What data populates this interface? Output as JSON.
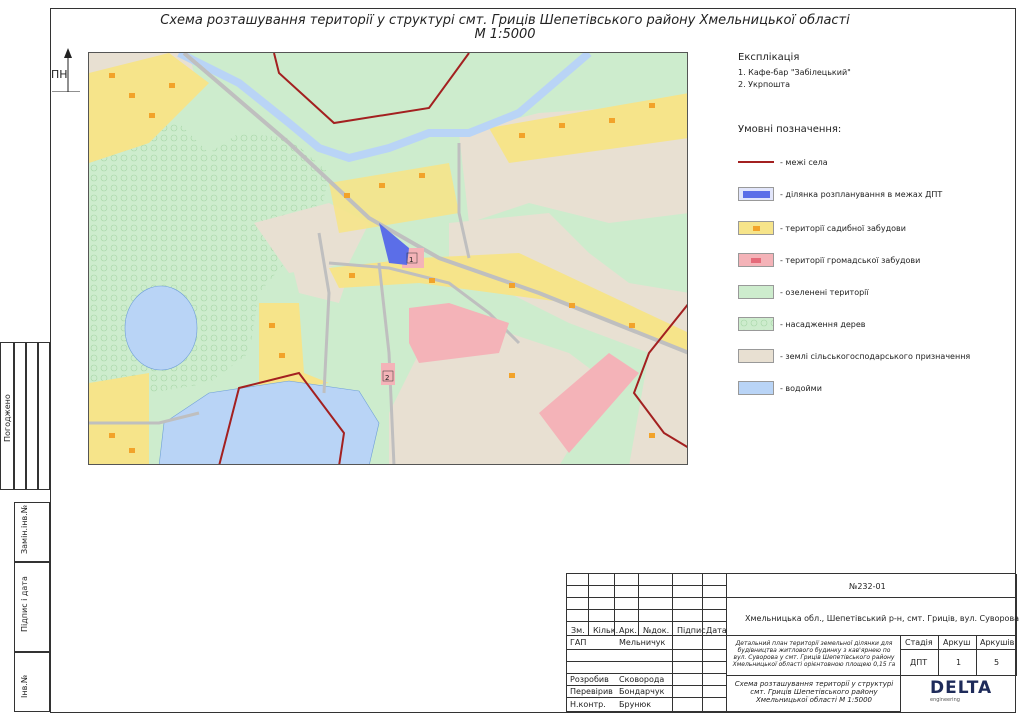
{
  "title": {
    "line1": "Схема розташування території у структурі смт. Гриців Шепетівського району Хмельницької області",
    "line2": "М 1:5000"
  },
  "north_label": "ПН",
  "map_labels": {
    "site1": "1",
    "site2": "2"
  },
  "legend": {
    "explication_heading": "Експлікація",
    "explication_items": [
      "1. Кафе-бар \"Забілецький\"",
      "2. Укрпошта"
    ],
    "symbols_heading": "Умовні позначення:",
    "items": [
      {
        "label": "- межі села",
        "kind": "line",
        "color": "#a32020"
      },
      {
        "label": "- ділянка розпланування в межах ДПТ",
        "kind": "fill",
        "color": "#5b6ee8"
      },
      {
        "label": "- території садибної забудови",
        "kind": "fill",
        "color": "#f6e48a"
      },
      {
        "label": "- території громадської забудови",
        "kind": "fill",
        "color": "#f4b3b8"
      },
      {
        "label": "- озеленені території",
        "kind": "fill",
        "color": "#cdeccd"
      },
      {
        "label": "- насадження дерев",
        "kind": "fill",
        "color": "#cdeccd"
      },
      {
        "label": "- землі сільськогосподарського призначення",
        "kind": "fill",
        "color": "#e8e0d2"
      },
      {
        "label": "- водойми",
        "kind": "fill",
        "color": "#b9d4f6"
      }
    ]
  },
  "side": {
    "agreed": "Погоджено",
    "replaced": "Замін.інв.№",
    "sign_date": "Підпис і дата",
    "inv": "Інв.№"
  },
  "stamp": {
    "doc_number": "№232-01",
    "location": "Хмельницька обл., Шепетівський р-н, смт. Гриців, вул. Суворова",
    "headers": [
      "Зм.",
      "Кільк.",
      "Арк.",
      "№док.",
      "Підпис",
      "Дата"
    ],
    "roles": [
      {
        "role": "ГАП",
        "name": "Мельничук"
      },
      {
        "role": "Розробив",
        "name": "Сковорода"
      },
      {
        "role": "Перевірив",
        "name": "Бондарчук"
      },
      {
        "role": "Н.контр.",
        "name": "Брунюк"
      }
    ],
    "project_desc": "Детальний план території земельної ділянки для будівництва житлового будинку з кав'ярнею по вул. Суворова у смт. Гриців Шепетівського району Хмельницької області орієнтовною площею 0,15 га",
    "stage_header": "Стадія",
    "sheet_header": "Аркуш",
    "sheets_header": "Аркушів",
    "stage": "ДПТ",
    "sheet": "1",
    "sheets": "5",
    "drawing_title": "Схема розташування території у структурі смт. Гриців Шепетівського району Хмельницької області М 1:5000",
    "company": "DELTA",
    "company_sub": "engineering"
  }
}
